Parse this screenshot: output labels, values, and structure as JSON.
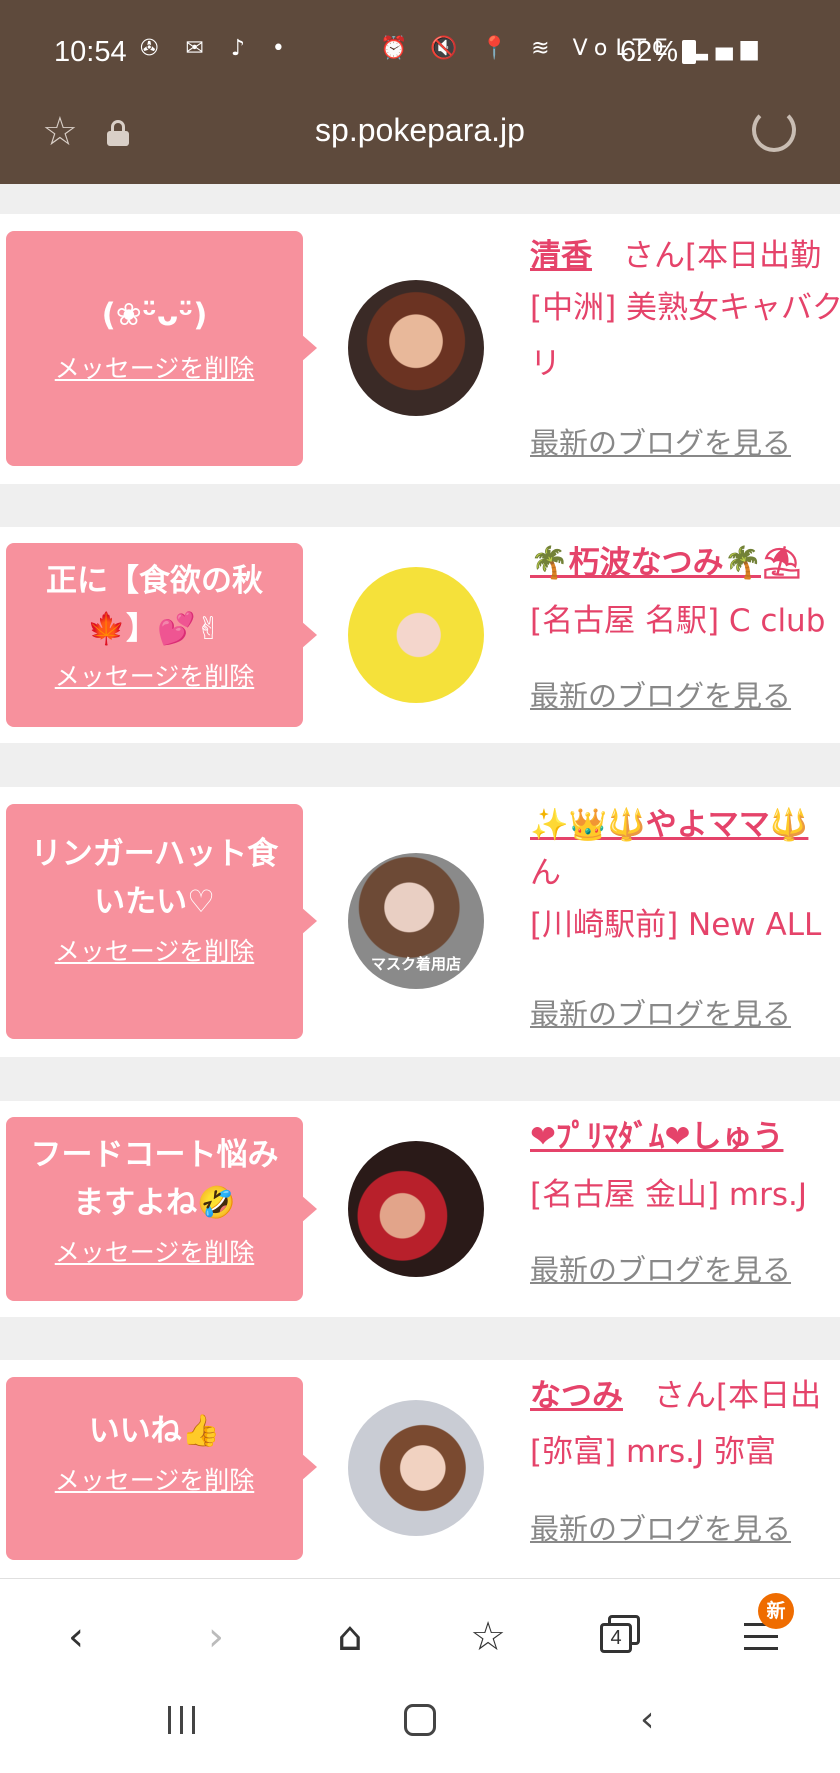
{
  "status_bar": {
    "time": "10:54",
    "battery": "62%",
    "left_icons": "✇ ✉ ♪ •",
    "right_icons": "⏰ 🔇 📍 ≋ VoLTE ▂▄▆"
  },
  "browser": {
    "url": "sp.pokepara.jp"
  },
  "colors": {
    "header_brown": "#5e4a3c",
    "bubble_pink": "#f7919d",
    "name_pink": "#e5436a",
    "badge_orange": "#ef6c00"
  },
  "entries": [
    {
      "message": "(❀ᵕ̈ᴗᵕ̈)",
      "delete_label": "メッセージを削除",
      "name": "清香",
      "name_suffix": "　さん[本日出勤",
      "shop": "[中洲] 美熟女キャバク",
      "shop_cont": "リ",
      "blog_label": "最新のブログを見る"
    },
    {
      "message": "正に【食欲の秋🍁】💕✌",
      "delete_label": "メッセージを削除",
      "name": "🌴朽波なつみ🌴⛱",
      "name_suffix": "",
      "shop": "[名古屋 名駅] C club",
      "shop_cont": "",
      "blog_label": "最新のブログを見る"
    },
    {
      "message": "リンガーハット食いたい♡",
      "delete_label": "メッセージを削除",
      "name": "✨👑🔱やよママ🔱",
      "name_suffix": "",
      "name_cont": "ん",
      "shop": "[川崎駅前] New ALL",
      "shop_cont": "",
      "blog_label": "最新のブログを見る",
      "avatar_caption": "マスク着用店"
    },
    {
      "message": "フードコート悩みますよね🤣",
      "delete_label": "メッセージを削除",
      "name": "❤ﾌﾟﾘﾏﾀﾞﾑ❤しゅう",
      "name_suffix": "",
      "shop": "[名古屋 金山] mrs.J",
      "shop_cont": "",
      "blog_label": "最新のブログを見る"
    },
    {
      "message": "いいね👍",
      "delete_label": "メッセージを削除",
      "name": "なつみ",
      "name_suffix": "　さん[本日出",
      "shop": "[弥富] mrs.J 弥富",
      "shop_cont": "",
      "blog_label": "最新のブログを見る"
    }
  ],
  "toolbar": {
    "tab_count": "4",
    "new_badge": "新"
  }
}
